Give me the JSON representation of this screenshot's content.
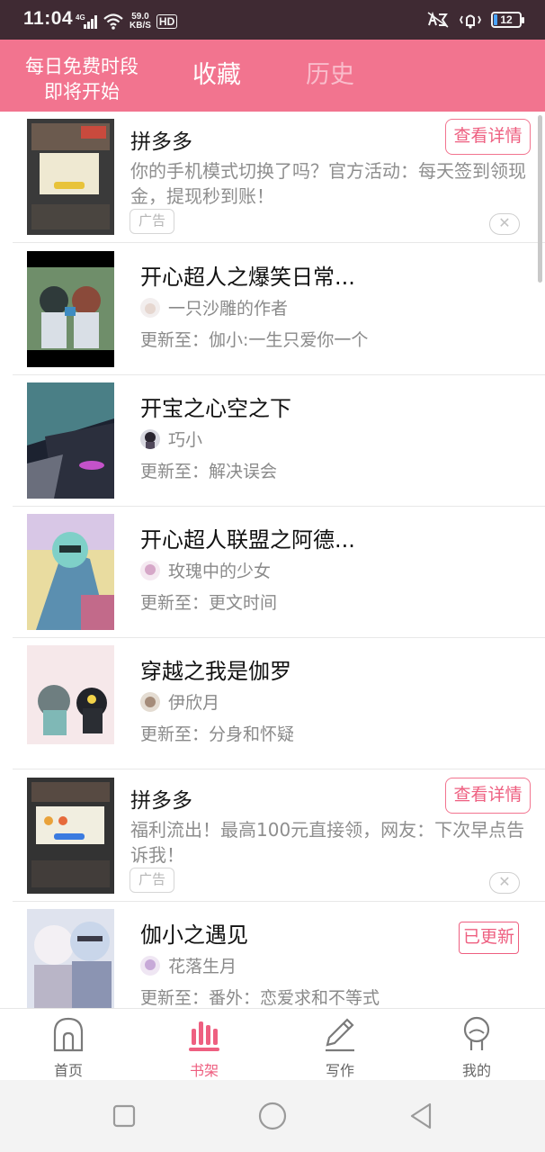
{
  "status_bar": {
    "time": "11:04",
    "network": "4G",
    "speed_value": "59.0",
    "speed_unit": "KB/S",
    "hd": "HD",
    "battery": "12",
    "battery_level": 0.12
  },
  "header": {
    "promo_line1": "每日免费时段",
    "promo_line2": "即将开始",
    "tabs": [
      {
        "label": "收藏",
        "active": true
      },
      {
        "label": "历史",
        "active": false
      }
    ]
  },
  "list": [
    {
      "kind": "ad",
      "title": "拼多多",
      "desc": "你的手机模式切换了吗？官方活动：每天签到领现金，提现秒到账！",
      "badge": "广告",
      "button": "查看详情",
      "close": "✕"
    },
    {
      "kind": "book",
      "title": "开心超人之爆笑日常...",
      "author": "一只沙雕的作者",
      "update": "更新至：伽小:一生只爱你一个"
    },
    {
      "kind": "book",
      "title": "开宝之心空之下",
      "author": "巧小",
      "update": "更新至：解决误会"
    },
    {
      "kind": "book",
      "title": "开心超人联盟之阿德...",
      "author": "玫瑰中的少女",
      "update": "更新至：更文时间"
    },
    {
      "kind": "book",
      "title": "穿越之我是伽罗",
      "author": "伊欣月",
      "update": "更新至：分身和怀疑"
    },
    {
      "kind": "ad",
      "title": "拼多多",
      "desc": "福利流出！最高100元直接领，网友：下次早点告诉我！",
      "badge": "广告",
      "button": "查看详情",
      "close": "✕"
    },
    {
      "kind": "book",
      "title": "伽小之遇见",
      "author": "花落生月",
      "update": "更新至：番外：恋爱求和不等式",
      "badge": "已更新"
    }
  ],
  "bottom_nav": [
    {
      "label": "首页",
      "icon": "home-icon",
      "active": false
    },
    {
      "label": "书架",
      "icon": "bookshelf-icon",
      "active": true
    },
    {
      "label": "写作",
      "icon": "pencil-icon",
      "active": false
    },
    {
      "label": "我的",
      "icon": "profile-icon",
      "active": false
    }
  ],
  "colors": {
    "accent": "#f2748f",
    "accent_text": "#ee5f80",
    "status_bar": "#3f2a33"
  }
}
